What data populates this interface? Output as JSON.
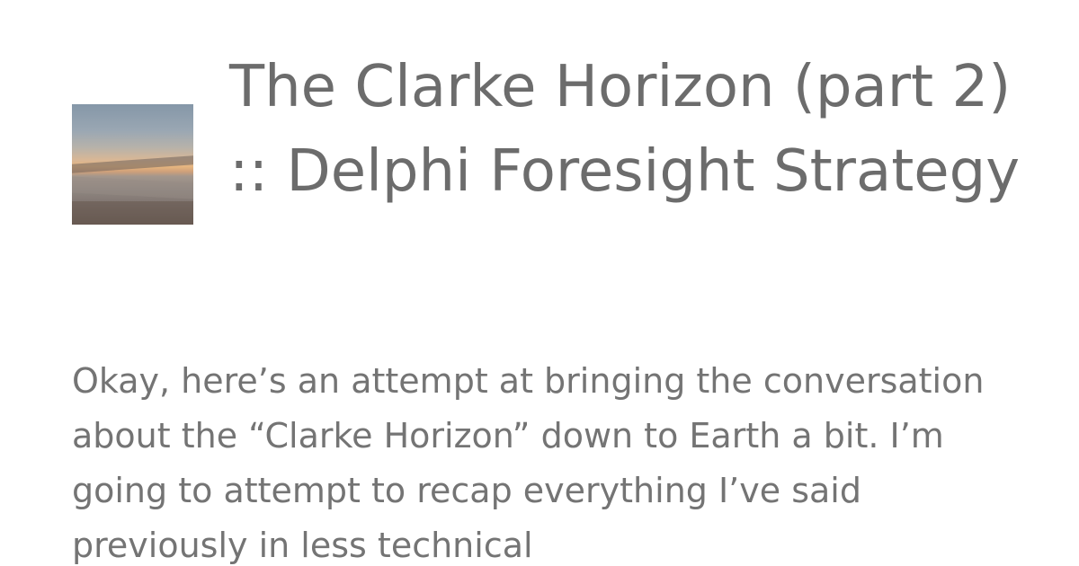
{
  "post": {
    "thumbnail_alt": "sunset-over-clouds",
    "title": "The Clarke Horizon (part 2) :: Delphi Foresight Strategy",
    "excerpt": "Okay, here’s an attempt at bringing the conversation about the “Clarke Horizon” down to Earth a bit. I’m going to attempt to recap everything I’ve said previously in less technical"
  },
  "colors": {
    "background": "#ffffff",
    "title_text": "#6c6c6c",
    "body_text": "#747474"
  }
}
